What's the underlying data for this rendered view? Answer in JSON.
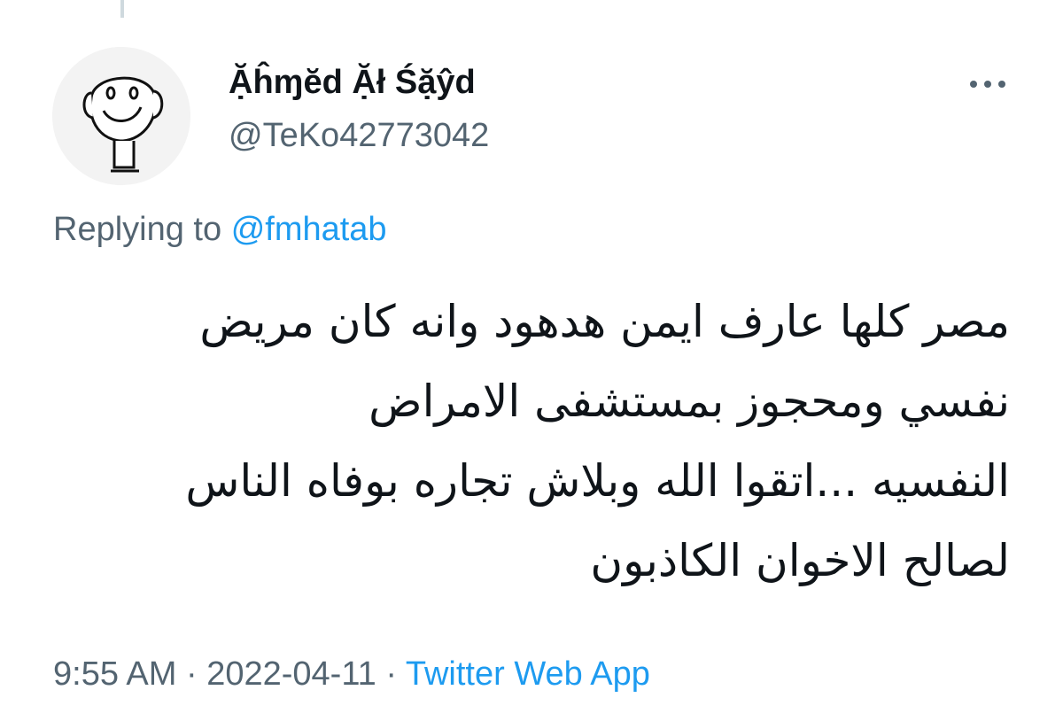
{
  "user": {
    "display_name": "Ặĥɱĕd Ặł Śặŷd",
    "handle": "@TeKo42773042",
    "avatar_icon": "cartoon-face-avatar"
  },
  "more_icon": "ellipsis-icon",
  "reply": {
    "prefix": "Replying to",
    "mention": "@fmhatab"
  },
  "tweet": {
    "lines": [
      "مصر كلها عارف ايمن هدهود وانه كان مريض",
      "نفسي ومحجوز بمستشفى الامراض",
      "النفسيه ...اتقوا الله وبلاش تجاره بوفاه الناس",
      "لصالح الاخوان الكاذبون"
    ]
  },
  "meta": {
    "time": "9:55 AM",
    "separator": "·",
    "date": "2022-04-11",
    "source": "Twitter Web App"
  },
  "colors": {
    "text": "#0f1419",
    "secondary": "#536471",
    "link": "#1d9bf0"
  }
}
